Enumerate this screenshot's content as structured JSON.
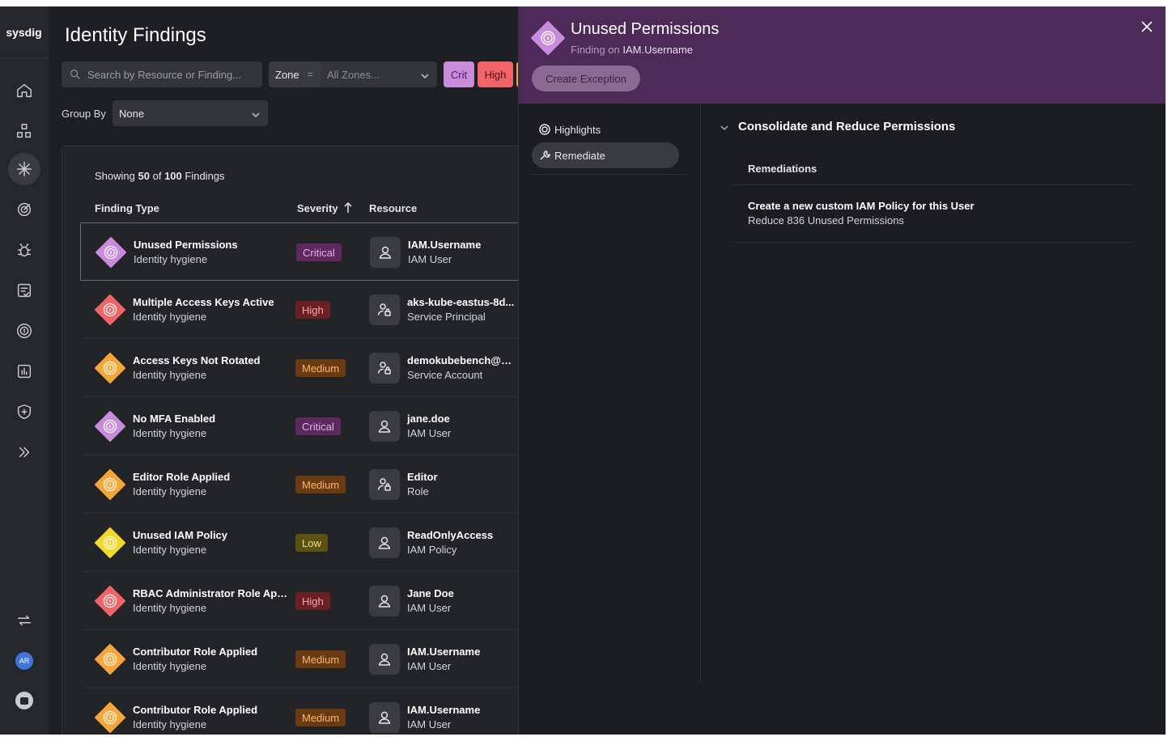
{
  "app": {
    "logo": "sysdig",
    "user_initials": "AR"
  },
  "page": {
    "title": "Identity Findings",
    "search_placeholder": "Search by Resource or Finding...",
    "zone_label": "Zone",
    "zone_operator": "=",
    "zone_value": "All Zones...",
    "severity_chips": [
      "Crit",
      "High"
    ],
    "group_by_label": "Group By",
    "group_by_value": "None",
    "showing_prefix": "Showing",
    "showing_count": "50",
    "showing_of": "of",
    "showing_total": "100",
    "showing_suffix": "Findings",
    "columns": {
      "finding_type": "Finding Type",
      "severity": "Severity",
      "resource": "Resource"
    }
  },
  "colors": {
    "critical": "#c98bdc",
    "high": "#f16468",
    "medium": "#f4a738",
    "low": "#f1d92c",
    "drawer_header": "#4e2a59"
  },
  "findings": [
    {
      "name": "Unused Permissions",
      "category": "Identity hygiene",
      "severity": "Critical",
      "level": "critical",
      "resource": "IAM.Username",
      "resource_type": "IAM User",
      "icon": "user-icon",
      "selected": true
    },
    {
      "name": "Multiple Access Keys Active",
      "category": "Identity hygiene",
      "severity": "High",
      "level": "high",
      "resource": "aks-kube-eastus-8d...",
      "resource_type": "Service Principal",
      "icon": "service-icon"
    },
    {
      "name": "Access Keys Not Rotated",
      "category": "Identity hygiene",
      "severity": "Medium",
      "level": "medium",
      "resource": "demokubebench@m...",
      "resource_type": "Service Account",
      "icon": "service-icon"
    },
    {
      "name": "No MFA Enabled",
      "category": "Identity hygiene",
      "severity": "Critical",
      "level": "critical",
      "resource": "jane.doe",
      "resource_type": "IAM User",
      "icon": "user-icon"
    },
    {
      "name": "Editor Role Applied",
      "category": "Identity hygiene",
      "severity": "Medium",
      "level": "medium",
      "resource": "Editor",
      "resource_type": "Role",
      "icon": "service-icon"
    },
    {
      "name": "Unused IAM Policy",
      "category": "Identity hygiene",
      "severity": "Low",
      "level": "low",
      "resource": "ReadOnlyAccess",
      "resource_type": "IAM Policy",
      "icon": "user-icon"
    },
    {
      "name": "RBAC Administrator Role Appli...",
      "category": "Identity hygiene",
      "severity": "High",
      "level": "high",
      "resource": "Jane Doe",
      "resource_type": "IAM User",
      "icon": "user-icon"
    },
    {
      "name": "Contributor Role Applied",
      "category": "Identity hygiene",
      "severity": "Medium",
      "level": "medium",
      "resource": "IAM.Username",
      "resource_type": "IAM User",
      "icon": "user-icon"
    },
    {
      "name": "Contributor Role Applied",
      "category": "Identity hygiene",
      "severity": "Medium",
      "level": "medium",
      "resource": "IAM.Username",
      "resource_type": "IAM User",
      "icon": "user-icon"
    }
  ],
  "drawer": {
    "title": "Unused Permissions",
    "subtitle_prefix": "Finding on",
    "subtitle_resource": "IAM.Username",
    "create_exception": "Create Exception",
    "tabs": [
      "Highlights",
      "Remediate"
    ],
    "active_tab": "Remediate",
    "section_title": "Consolidate and Reduce Permissions",
    "remediations_heading": "Remediations",
    "remediation_title": "Create a new custom IAM Policy for this User",
    "remediation_detail": "Reduce 836 Unused Permissions"
  }
}
